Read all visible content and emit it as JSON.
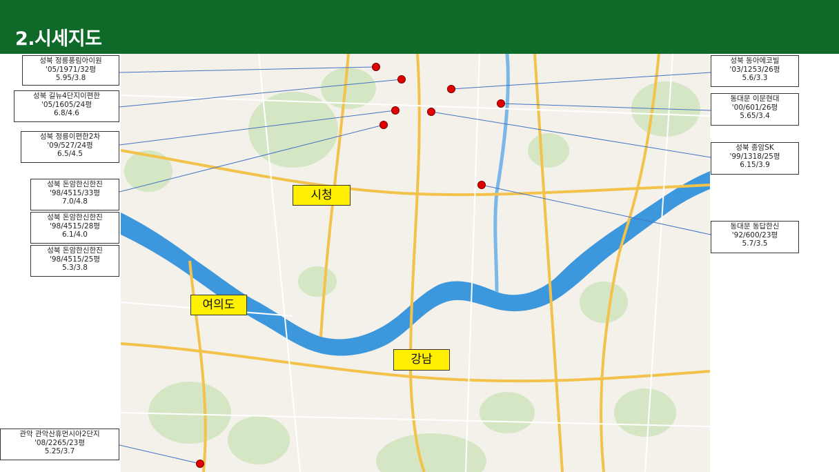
{
  "title": "2.시세지도",
  "colors": {
    "header": "#0f6a2a",
    "marker": "#e00000",
    "area_label": "#ffef00",
    "river": "#2f8fd8"
  },
  "area_labels": [
    {
      "text": "시청"
    },
    {
      "text": "여의도"
    },
    {
      "text": "강남"
    }
  ],
  "listings": [
    {
      "name": "성북 정릉풍림아이원",
      "info": "'05/1971/32평",
      "price": "5.95/3.8"
    },
    {
      "name": "성북 길뉴4단지이편한",
      "info": "'05/1605/24평",
      "price": "6.8/4.6"
    },
    {
      "name": "성북 정릉이편한2차",
      "info": "'09/527/24평",
      "price": "6.5/4.5"
    },
    {
      "name": "성북 돈암한신한진",
      "info": "'98/4515/33평",
      "price": "7.0/4.8"
    },
    {
      "name": "성북 돈암한신한진",
      "info": "'98/4515/28평",
      "price": "6.1/4.0"
    },
    {
      "name": "성북 돈암한신한진",
      "info": "'98/4515/25평",
      "price": "5.3/3.8"
    },
    {
      "name": "관악 관악산휴먼시아2단지",
      "info": "'08/2265/23평",
      "price": "5.25/3.7"
    },
    {
      "name": "성북 동아에코빌",
      "info": "'03/1253/26평",
      "price": "5.6/3.3"
    },
    {
      "name": "동대문 이문현대",
      "info": "'00/601/26평",
      "price": "5.65/3.4"
    },
    {
      "name": "성북 종암SK",
      "info": "'99/1318/25평",
      "price": "6.15/3.9"
    },
    {
      "name": "동대문 동답한신",
      "info": "'92/600/23평",
      "price": "5.7/3.5"
    }
  ]
}
